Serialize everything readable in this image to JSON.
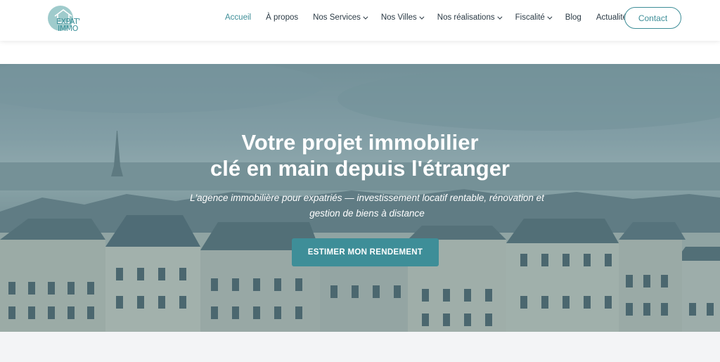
{
  "logo": {
    "line1": "EXPAT'",
    "line2": "IMMO"
  },
  "nav": {
    "items": [
      {
        "label": "Accueil",
        "active": true,
        "dropdown": false
      },
      {
        "label": "À propos",
        "active": false,
        "dropdown": false
      },
      {
        "label": "Nos Services",
        "active": false,
        "dropdown": true
      },
      {
        "label": "Nos Villes",
        "active": false,
        "dropdown": true
      },
      {
        "label": "Nos réalisations",
        "active": false,
        "dropdown": true
      },
      {
        "label": "Fiscalité",
        "active": false,
        "dropdown": true
      },
      {
        "label": "Blog",
        "active": false,
        "dropdown": false
      },
      {
        "label": "Actualités",
        "active": false,
        "dropdown": false
      }
    ],
    "contact": "Contact"
  },
  "hero": {
    "title_line1": "Votre projet immobilier",
    "title_line2": "clé en main depuis l'étranger",
    "subtitle": "L'agence immobilière pour expatriés — investissement locatif rentable, rénovation et gestion de biens à distance",
    "cta": "ESTIMER MON RENDEMENT"
  },
  "colors": {
    "accent": "#3e8e98",
    "nav_text": "#2b3a45",
    "bottom_bg": "#f3f4f6"
  }
}
